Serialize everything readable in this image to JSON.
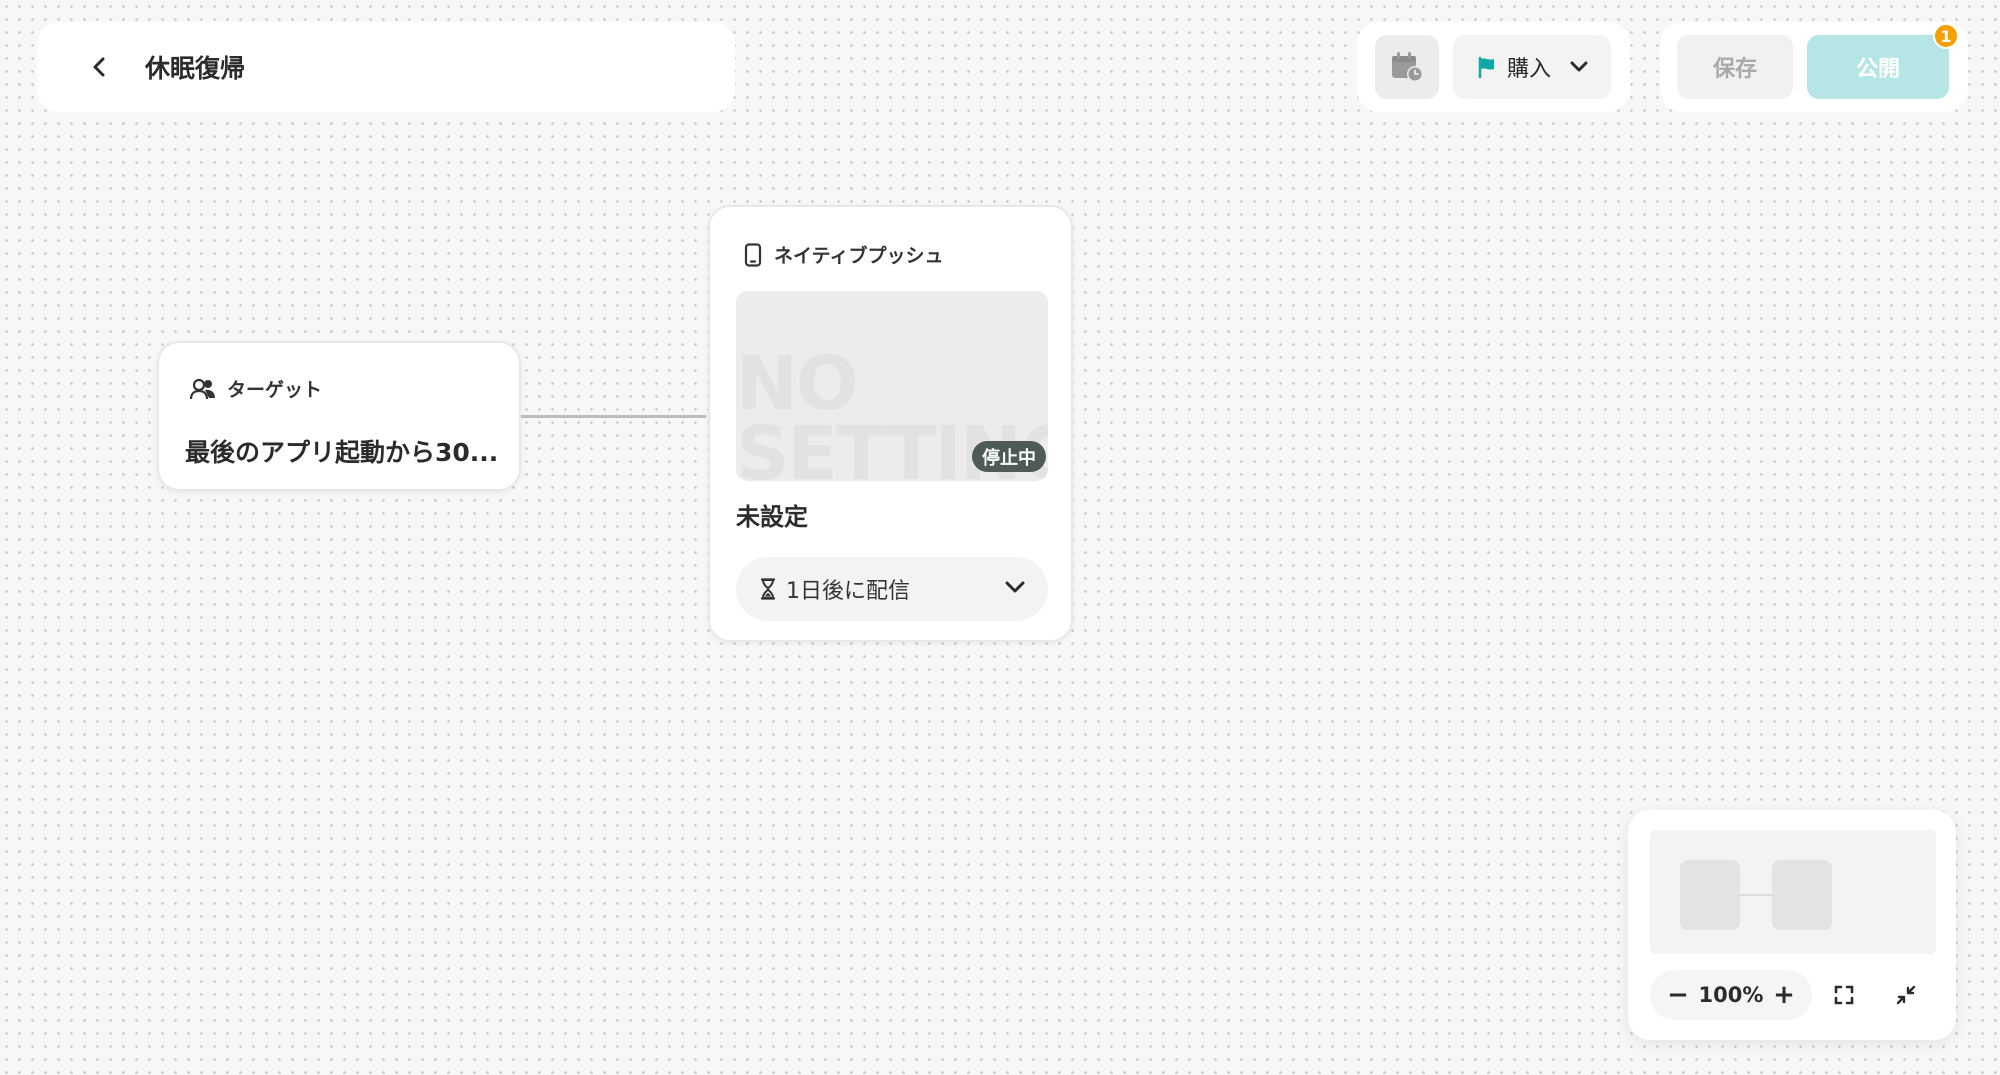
{
  "header": {
    "title": "休眠復帰",
    "back_icon": "chevron-left-icon"
  },
  "toolbar": {
    "schedule_icon": "calendar-clock-icon",
    "goal_icon": "flag-icon",
    "goal_label": "購入",
    "save_label": "保存",
    "publish_label": "公開",
    "publish_badge": "1"
  },
  "nodes": {
    "target": {
      "type_label": "ターゲット",
      "icon": "users-icon",
      "condition": "最後のアプリ起動から30..."
    },
    "push": {
      "type_label": "ネイティブプッシュ",
      "icon": "smartphone-icon",
      "preview_watermark": "NO\nSETTING",
      "status": "停止中",
      "title": "未設定",
      "delay_icon": "hourglass-icon",
      "delay_label": "1日後に配信"
    }
  },
  "minimap": {
    "zoom_level": "100%",
    "zoom_out_label": "−",
    "zoom_in_label": "+"
  },
  "colors": {
    "accent": "#11a7a5",
    "publish_bg": "#b5e5e4",
    "badge": "#f5a000",
    "status_bg": "#4e5a57"
  }
}
